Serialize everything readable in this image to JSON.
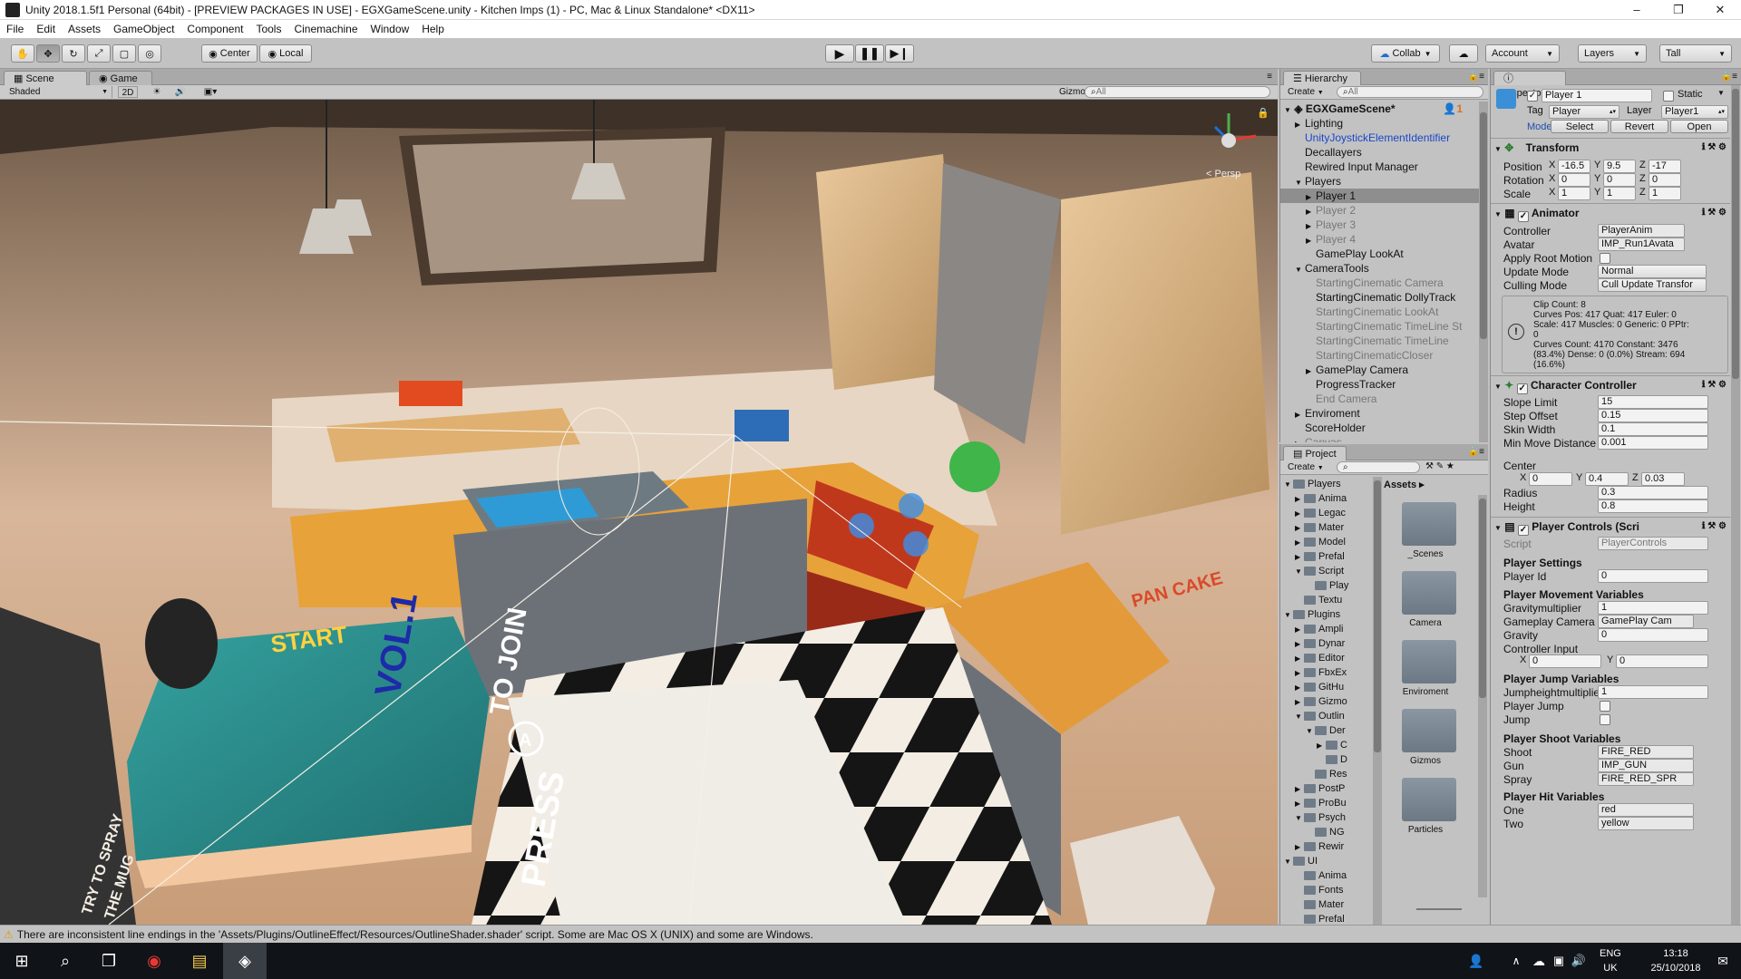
{
  "window": {
    "title": "Unity 2018.1.5f1 Personal (64bit) - [PREVIEW PACKAGES IN USE] - EGXGameScene.unity - Kitchen Imps (1) - PC, Mac & Linux Standalone* <DX11>"
  },
  "menu": [
    "File",
    "Edit",
    "Assets",
    "GameObject",
    "Component",
    "Tools",
    "Cinemachine",
    "Window",
    "Help"
  ],
  "toolbar": {
    "pivot": "Center",
    "space": "Local",
    "collab": "Collab",
    "account": "Account",
    "layers": "Layers",
    "layout": "Tall"
  },
  "scene": {
    "tab_scene": "Scene",
    "tab_game": "Game",
    "shading": "Shaded",
    "mode_2d": "2D",
    "gizmos": "Gizmos",
    "search_placeholder": "All",
    "persp": "Persp",
    "overlay": {
      "start": "START",
      "vol": "VOL.1",
      "press": "PRESS",
      "to_join": "TO JOIN",
      "button_letter": "A",
      "try": "TRY TO SPRAY",
      "the_mug": "THE MUG",
      "pancake": "PAN CAKE"
    }
  },
  "hierarchy": {
    "tab": "Hierarchy",
    "create": "Create",
    "search_placeholder": "All",
    "scene_name": "EGXGameScene*",
    "player_count": "1",
    "items": [
      {
        "label": "Lighting",
        "style": "normal",
        "indent": 1,
        "arrow": "▶"
      },
      {
        "label": "UnityJoystickElementIdentifier",
        "style": "blue",
        "indent": 1,
        "arrow": ""
      },
      {
        "label": "Decallayers",
        "style": "normal",
        "indent": 1,
        "arrow": ""
      },
      {
        "label": "Rewired Input Manager",
        "style": "normal",
        "indent": 1,
        "arrow": ""
      },
      {
        "label": "Players",
        "style": "normal",
        "indent": 1,
        "arrow": "▼"
      },
      {
        "label": "Player 1",
        "style": "selected",
        "indent": 2,
        "arrow": "▶"
      },
      {
        "label": "Player 2",
        "style": "grey",
        "indent": 2,
        "arrow": "▶"
      },
      {
        "label": "Player 3",
        "style": "grey",
        "indent": 2,
        "arrow": "▶"
      },
      {
        "label": "Player 4",
        "style": "grey",
        "indent": 2,
        "arrow": "▶"
      },
      {
        "label": "GamePlay LookAt",
        "style": "normal",
        "indent": 2,
        "arrow": ""
      },
      {
        "label": "CameraTools",
        "style": "normal",
        "indent": 1,
        "arrow": "▼"
      },
      {
        "label": "StartingCinematic Camera",
        "style": "grey",
        "indent": 2,
        "arrow": ""
      },
      {
        "label": "StartingCinematic DollyTrack",
        "style": "normal",
        "indent": 2,
        "arrow": ""
      },
      {
        "label": "StartingCinematic LookAt",
        "style": "grey",
        "indent": 2,
        "arrow": ""
      },
      {
        "label": "StartingCinematic TimeLine St",
        "style": "grey",
        "indent": 2,
        "arrow": ""
      },
      {
        "label": "StartingCinematic TimeLine",
        "style": "grey",
        "indent": 2,
        "arrow": ""
      },
      {
        "label": "StartingCinematicCloser",
        "style": "grey",
        "indent": 2,
        "arrow": ""
      },
      {
        "label": "GamePlay Camera",
        "style": "normal",
        "indent": 2,
        "arrow": "▶"
      },
      {
        "label": "ProgressTracker",
        "style": "normal",
        "indent": 2,
        "arrow": ""
      },
      {
        "label": "End Camera",
        "style": "grey",
        "indent": 2,
        "arrow": ""
      },
      {
        "label": "Enviroment",
        "style": "normal",
        "indent": 1,
        "arrow": "▶"
      },
      {
        "label": "ScoreHolder",
        "style": "normal",
        "indent": 1,
        "arrow": ""
      },
      {
        "label": "Canvas",
        "style": "grey",
        "indent": 1,
        "arrow": "▶"
      }
    ]
  },
  "project": {
    "tab": "Project",
    "create": "Create",
    "breadcrumb": "Assets",
    "tree": [
      {
        "label": "Players",
        "indent": 0,
        "arrow": "▼"
      },
      {
        "label": "Anima",
        "indent": 1,
        "arrow": "▶"
      },
      {
        "label": "Legac",
        "indent": 1,
        "arrow": "▶"
      },
      {
        "label": "Mater",
        "indent": 1,
        "arrow": "▶"
      },
      {
        "label": "Model",
        "indent": 1,
        "arrow": "▶"
      },
      {
        "label": "Prefal",
        "indent": 1,
        "arrow": "▶"
      },
      {
        "label": "Script",
        "indent": 1,
        "arrow": "▼"
      },
      {
        "label": "Play",
        "indent": 2,
        "arrow": ""
      },
      {
        "label": "Textu",
        "indent": 1,
        "arrow": ""
      },
      {
        "label": "Plugins",
        "indent": 0,
        "arrow": "▼"
      },
      {
        "label": "Ampli",
        "indent": 1,
        "arrow": "▶"
      },
      {
        "label": "Dynar",
        "indent": 1,
        "arrow": "▶"
      },
      {
        "label": "Editor",
        "indent": 1,
        "arrow": "▶"
      },
      {
        "label": "FbxEx",
        "indent": 1,
        "arrow": "▶"
      },
      {
        "label": "GitHu",
        "indent": 1,
        "arrow": "▶"
      },
      {
        "label": "Gizmo",
        "indent": 1,
        "arrow": "▶"
      },
      {
        "label": "Outlin",
        "indent": 1,
        "arrow": "▼"
      },
      {
        "label": "Der",
        "indent": 2,
        "arrow": "▼"
      },
      {
        "label": "C",
        "indent": 3,
        "arrow": "▶"
      },
      {
        "label": "D",
        "indent": 3,
        "arrow": ""
      },
      {
        "label": "Res",
        "indent": 2,
        "arrow": ""
      },
      {
        "label": "PostP",
        "indent": 1,
        "arrow": "▶"
      },
      {
        "label": "ProBu",
        "indent": 1,
        "arrow": "▶"
      },
      {
        "label": "Psych",
        "indent": 1,
        "arrow": "▼"
      },
      {
        "label": "NG",
        "indent": 2,
        "arrow": ""
      },
      {
        "label": "Rewir",
        "indent": 1,
        "arrow": "▶"
      },
      {
        "label": "UI",
        "indent": 0,
        "arrow": "▼"
      },
      {
        "label": "Anima",
        "indent": 1,
        "arrow": ""
      },
      {
        "label": "Fonts",
        "indent": 1,
        "arrow": ""
      },
      {
        "label": "Mater",
        "indent": 1,
        "arrow": ""
      },
      {
        "label": "Prefal",
        "indent": 1,
        "arrow": ""
      }
    ],
    "assets": [
      "_Scenes",
      "Camera",
      "Enviroment",
      "Gizmos",
      "Particles"
    ]
  },
  "inspector": {
    "tab": "Inspector",
    "object_name": "Player 1",
    "static": "Static",
    "tag_label": "Tag",
    "tag": "Player",
    "layer_label": "Layer",
    "layer": "Player1",
    "model_label": "Model",
    "btn_select": "Select",
    "btn_revert": "Revert",
    "btn_open": "Open",
    "transform": {
      "title": "Transform",
      "position_label": "Position",
      "position": [
        "-16.5",
        "9.5",
        "-17"
      ],
      "rotation_label": "Rotation",
      "rotation": [
        "0",
        "0",
        "0"
      ],
      "scale_label": "Scale",
      "scale": [
        "1",
        "1",
        "1"
      ]
    },
    "animator": {
      "title": "Animator",
      "controller_label": "Controller",
      "controller": "PlayerAnim",
      "avatar_label": "Avatar",
      "avatar": "IMP_Run1Avata",
      "root_motion_label": "Apply Root Motion",
      "update_mode_label": "Update Mode",
      "update_mode": "Normal",
      "culling_mode_label": "Culling Mode",
      "culling_mode": "Cull Update Transfor",
      "info": [
        "Clip Count: 8",
        "Curves Pos: 417 Quat: 417 Euler: 0",
        "Scale: 417 Muscles: 0 Generic: 0 PPtr:",
        "0",
        "Curves Count: 4170 Constant: 3476",
        "(83.4%) Dense: 0 (0.0%) Stream: 694",
        "(16.6%)"
      ]
    },
    "character_controller": {
      "title": "Character Controller",
      "rows": [
        {
          "label": "Slope Limit",
          "value": "15"
        },
        {
          "label": "Step Offset",
          "value": "0.15"
        },
        {
          "label": "Skin Width",
          "value": "0.1"
        },
        {
          "label": "Min Move Distance",
          "value": "0.001"
        }
      ],
      "center_label": "Center",
      "center": [
        "0",
        "0.4",
        "0.03"
      ],
      "radius_label": "Radius",
      "radius": "0.3",
      "height_label": "Height",
      "height": "0.8"
    },
    "player_controls": {
      "title": "Player Controls (Scri",
      "script_label": "Script",
      "script": "PlayerControls",
      "settings_title": "Player Settings",
      "player_id_label": "Player Id",
      "player_id": "0",
      "movement_title": "Player Movement Variables",
      "gravitymult_label": "Gravitymultiplier",
      "gravitymult": "1",
      "gp_camera_label": "Gameplay Camera",
      "gp_camera": "GamePlay Cam",
      "gravity_label": "Gravity",
      "gravity": "0",
      "controller_input_label": "Controller Input",
      "controller_input": [
        "0",
        "0"
      ],
      "jump_title": "Player Jump Variables",
      "jumpheight_label": "Jumpheightmultiplier",
      "jumpheight": "1",
      "player_jump_label": "Player Jump",
      "jump_label": "Jump",
      "shoot_title": "Player Shoot Variables",
      "shoot_label": "Shoot",
      "shoot": "FIRE_RED",
      "gun_label": "Gun",
      "gun": "IMP_GUN",
      "spray_label": "Spray",
      "spray": "FIRE_RED_SPR",
      "hit_title": "Player Hit Variables",
      "one_label": "One",
      "one": "red",
      "two_label": "Two",
      "two": "yellow"
    }
  },
  "status": {
    "message": "There are inconsistent line endings in the 'Assets/Plugins/OutlineEffect/Resources/OutlineShader.shader' script. Some are Mac OS X (UNIX) and some are Windows."
  },
  "taskbar": {
    "lang": "ENG",
    "region": "UK",
    "time": "13:18",
    "date": "25/10/2018"
  }
}
